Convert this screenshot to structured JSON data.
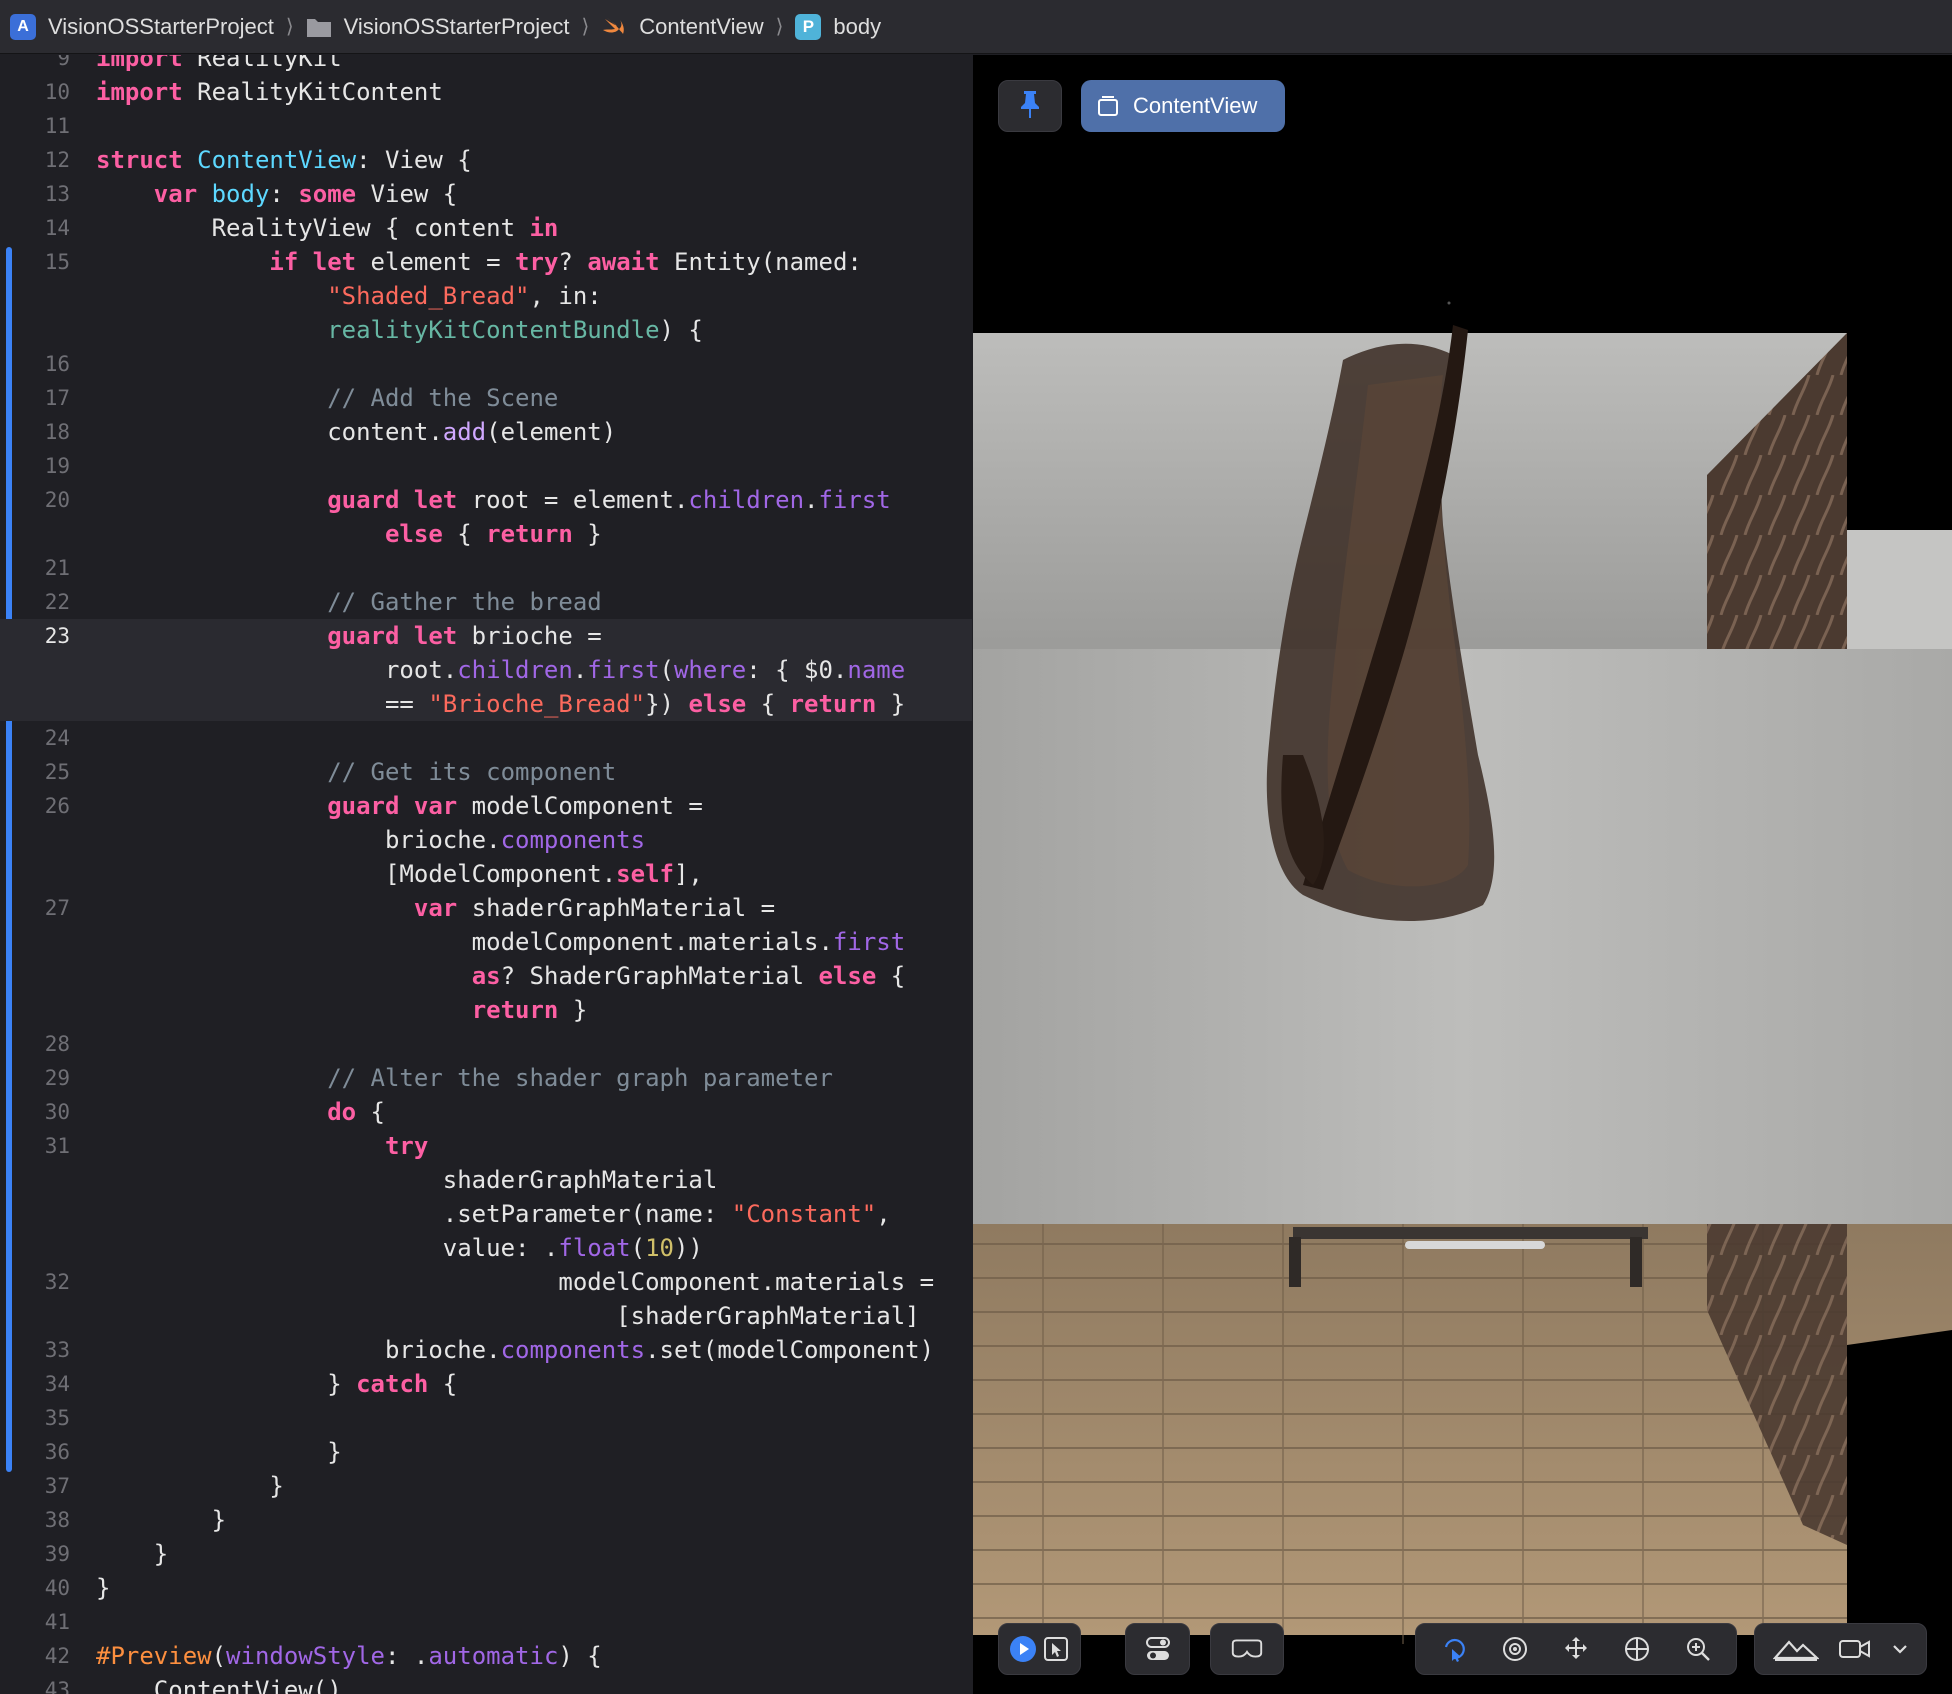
{
  "breadcrumb": {
    "project": "VisionOSStarterProject",
    "folder": "VisionOSStarterProject",
    "file": "ContentView",
    "symbol": "body",
    "symbol_badge": "P"
  },
  "editor": {
    "highlighted_line": "23",
    "lines": [
      {
        "n": "9",
        "t": [
          [
            "kw",
            "import"
          ],
          [
            "",
            " RealityKit"
          ]
        ]
      },
      {
        "n": "10",
        "t": [
          [
            "kw",
            "import"
          ],
          [
            "",
            " RealityKitContent"
          ]
        ]
      },
      {
        "n": "11",
        "t": []
      },
      {
        "n": "12",
        "t": [
          [
            "kw",
            "struct"
          ],
          [
            "",
            " "
          ],
          [
            "ty",
            "ContentView"
          ],
          [
            "",
            ": "
          ],
          [
            "",
            "View"
          ],
          [
            "",
            " {"
          ]
        ]
      },
      {
        "n": "13",
        "t": [
          [
            "",
            "    "
          ],
          [
            "kw",
            "var"
          ],
          [
            "",
            " "
          ],
          [
            "ty",
            "body"
          ],
          [
            "",
            ": "
          ],
          [
            "kw",
            "some"
          ],
          [
            "",
            " View {"
          ]
        ]
      },
      {
        "n": "14",
        "t": [
          [
            "",
            "        RealityView { content "
          ],
          [
            "kw",
            "in"
          ]
        ]
      },
      {
        "n": "15",
        "t": [
          [
            "",
            "            "
          ],
          [
            "kw",
            "if let"
          ],
          [
            "",
            " element = "
          ],
          [
            "kw",
            "try"
          ],
          [
            "",
            "? "
          ],
          [
            "kw",
            "await"
          ],
          [
            "",
            " Entity(named:"
          ]
        ]
      },
      {
        "n": "",
        "t": [
          [
            "",
            "                "
          ],
          [
            "st",
            "\"Shaded_Bread\""
          ],
          [
            "",
            ", in:"
          ]
        ]
      },
      {
        "n": "",
        "t": [
          [
            "",
            "                "
          ],
          [
            "tl",
            "realityKitContentBundle"
          ],
          [
            "",
            ") {"
          ]
        ]
      },
      {
        "n": "16",
        "t": []
      },
      {
        "n": "17",
        "t": [
          [
            "",
            "                "
          ],
          [
            "cm",
            "// Add the Scene"
          ]
        ]
      },
      {
        "n": "18",
        "t": [
          [
            "",
            "                content."
          ],
          [
            "fn",
            "add"
          ],
          [
            "",
            "(element)"
          ]
        ]
      },
      {
        "n": "19",
        "t": []
      },
      {
        "n": "20",
        "t": [
          [
            "",
            "                "
          ],
          [
            "kw",
            "guard let"
          ],
          [
            "",
            " root = element."
          ],
          [
            "pr",
            "children"
          ],
          [
            "",
            "."
          ],
          [
            "pr",
            "first"
          ]
        ]
      },
      {
        "n": "",
        "t": [
          [
            "",
            "                    "
          ],
          [
            "kw",
            "else"
          ],
          [
            "",
            " { "
          ],
          [
            "kw",
            "return"
          ],
          [
            "",
            " }"
          ]
        ]
      },
      {
        "n": "21",
        "t": []
      },
      {
        "n": "22",
        "t": [
          [
            "",
            "                "
          ],
          [
            "cm",
            "// Gather the bread"
          ]
        ]
      },
      {
        "n": "23",
        "t": [
          [
            "",
            "                "
          ],
          [
            "kw",
            "guard let"
          ],
          [
            "",
            " brioche ="
          ]
        ]
      },
      {
        "n": "",
        "t": [
          [
            "",
            "                    root."
          ],
          [
            "pr",
            "children"
          ],
          [
            "",
            "."
          ],
          [
            "pr",
            "first"
          ],
          [
            "",
            "("
          ],
          [
            "pr",
            "where"
          ],
          [
            "",
            ": { $0."
          ],
          [
            "pr",
            "name"
          ]
        ]
      },
      {
        "n": "",
        "t": [
          [
            "",
            "                    == "
          ],
          [
            "st",
            "\"Brioche_Bread\""
          ],
          [
            "",
            "}) "
          ],
          [
            "kw",
            "else"
          ],
          [
            "",
            " { "
          ],
          [
            "kw",
            "return"
          ],
          [
            "",
            " }"
          ]
        ]
      },
      {
        "n": "24",
        "t": []
      },
      {
        "n": "25",
        "t": [
          [
            "",
            "                "
          ],
          [
            "cm",
            "// Get its component"
          ]
        ]
      },
      {
        "n": "26",
        "t": [
          [
            "",
            "                "
          ],
          [
            "kw",
            "guard var"
          ],
          [
            "",
            " modelComponent ="
          ]
        ]
      },
      {
        "n": "",
        "t": [
          [
            "",
            "                    brioche."
          ],
          [
            "pr",
            "components"
          ]
        ]
      },
      {
        "n": "",
        "t": [
          [
            "",
            "                    [ModelComponent."
          ],
          [
            "kw",
            "self"
          ],
          [
            "",
            "],"
          ]
        ]
      },
      {
        "n": "27",
        "t": [
          [
            "",
            "                      "
          ],
          [
            "kw",
            "var"
          ],
          [
            "",
            " shaderGraphMaterial ="
          ]
        ]
      },
      {
        "n": "",
        "t": [
          [
            "",
            "                          modelComponent.materials."
          ],
          [
            "pr",
            "first"
          ]
        ]
      },
      {
        "n": "",
        "t": [
          [
            "",
            "                          "
          ],
          [
            "kw",
            "as"
          ],
          [
            "",
            "? ShaderGraphMaterial "
          ],
          [
            "kw",
            "else"
          ],
          [
            "",
            " {"
          ]
        ]
      },
      {
        "n": "",
        "t": [
          [
            "",
            "                          "
          ],
          [
            "kw",
            "return"
          ],
          [
            "",
            " }"
          ]
        ]
      },
      {
        "n": "28",
        "t": []
      },
      {
        "n": "29",
        "t": [
          [
            "",
            "                "
          ],
          [
            "cm",
            "// Alter the shader graph parameter"
          ]
        ]
      },
      {
        "n": "30",
        "t": [
          [
            "",
            "                "
          ],
          [
            "kw",
            "do"
          ],
          [
            "",
            " {"
          ]
        ]
      },
      {
        "n": "31",
        "t": [
          [
            "",
            "                    "
          ],
          [
            "kw",
            "try"
          ]
        ]
      },
      {
        "n": "",
        "t": [
          [
            "",
            "                        shaderGraphMaterial"
          ]
        ]
      },
      {
        "n": "",
        "t": [
          [
            "",
            "                        .setParameter(name: "
          ],
          [
            "st",
            "\"Constant\""
          ],
          [
            "",
            ","
          ]
        ]
      },
      {
        "n": "",
        "t": [
          [
            "",
            "                        value: ."
          ],
          [
            "pr",
            "float"
          ],
          [
            "",
            "("
          ],
          [
            "nm",
            "10"
          ],
          [
            "",
            "))"
          ]
        ]
      },
      {
        "n": "32",
        "t": [
          [
            "",
            "                                modelComponent.materials ="
          ]
        ]
      },
      {
        "n": "",
        "t": [
          [
            "",
            "                                    [shaderGraphMaterial]"
          ]
        ]
      },
      {
        "n": "33",
        "t": [
          [
            "",
            "                    brioche."
          ],
          [
            "pr",
            "components"
          ],
          [
            "",
            ".set(modelComponent)"
          ]
        ]
      },
      {
        "n": "34",
        "t": [
          [
            "",
            "                } "
          ],
          [
            "kw",
            "catch"
          ],
          [
            "",
            " {"
          ]
        ]
      },
      {
        "n": "35",
        "t": []
      },
      {
        "n": "36",
        "t": [
          [
            "",
            "                }"
          ]
        ]
      },
      {
        "n": "37",
        "t": [
          [
            "",
            "            }"
          ]
        ]
      },
      {
        "n": "38",
        "t": [
          [
            "",
            "        }"
          ]
        ]
      },
      {
        "n": "39",
        "t": [
          [
            "",
            "    }"
          ]
        ]
      },
      {
        "n": "40",
        "t": [
          [
            "",
            "}"
          ]
        ]
      },
      {
        "n": "41",
        "t": []
      },
      {
        "n": "42",
        "t": [
          [
            "pp",
            "#Preview"
          ],
          [
            "",
            "("
          ],
          [
            "pr",
            "windowStyle"
          ],
          [
            "",
            ": ."
          ],
          [
            "pr",
            "automatic"
          ],
          [
            "",
            ") {"
          ]
        ]
      },
      {
        "n": "43",
        "t": [
          [
            "",
            "    ContentView()"
          ]
        ]
      }
    ]
  },
  "canvas": {
    "preview_label": "ContentView",
    "accent_color": "#3b82f6",
    "toolbar_icons": [
      "live-play-icon",
      "select-icon",
      "variants-icon",
      "device-icon",
      "rotate-icon",
      "orbit-icon",
      "pan-icon",
      "globe-icon",
      "zoom-icon",
      "environment-icon",
      "camera-icon",
      "chevron-down-icon"
    ]
  }
}
